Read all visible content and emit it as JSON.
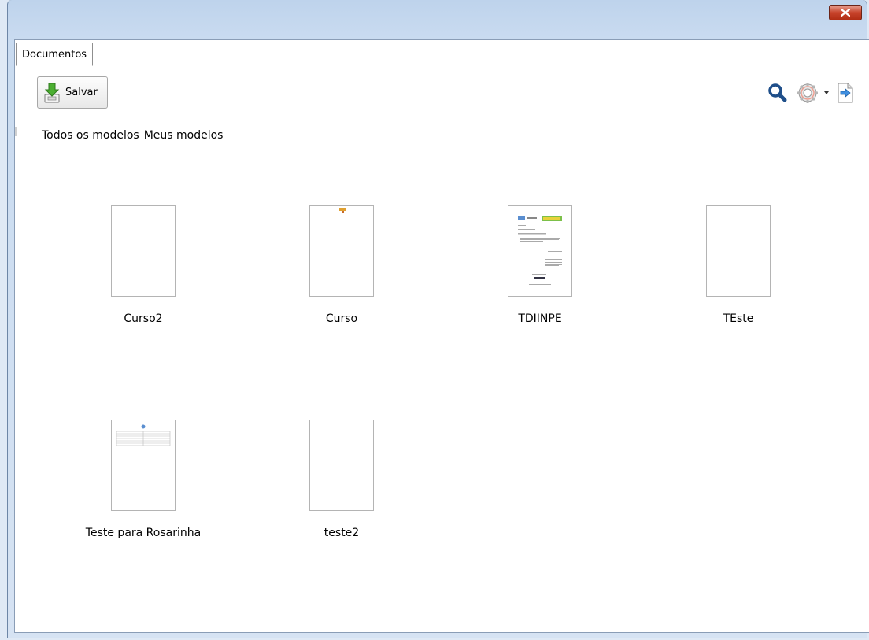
{
  "window": {
    "close_icon": "close-icon",
    "close_color": "#c7432b"
  },
  "tabs": [
    {
      "label": "Documentos"
    }
  ],
  "toolbar": {
    "save_label": "Salvar",
    "save_icon": "save-download-icon",
    "right_icons": [
      "search-icon",
      "gear-icon",
      "chevron-down-icon",
      "exit-icon"
    ]
  },
  "filters": [
    {
      "label": "Todos os modelos"
    },
    {
      "label": "Meus modelos"
    }
  ],
  "documents": [
    {
      "name": "Curso2",
      "thumbnail": "blank"
    },
    {
      "name": "Curso",
      "thumbnail": "logo-top"
    },
    {
      "name": "TDIINPE",
      "thumbnail": "letterhead-text"
    },
    {
      "name": "TEste",
      "thumbnail": "blank"
    },
    {
      "name": "Teste para Rosarinha",
      "thumbnail": "table"
    },
    {
      "name": "teste2",
      "thumbnail": "blank"
    }
  ]
}
